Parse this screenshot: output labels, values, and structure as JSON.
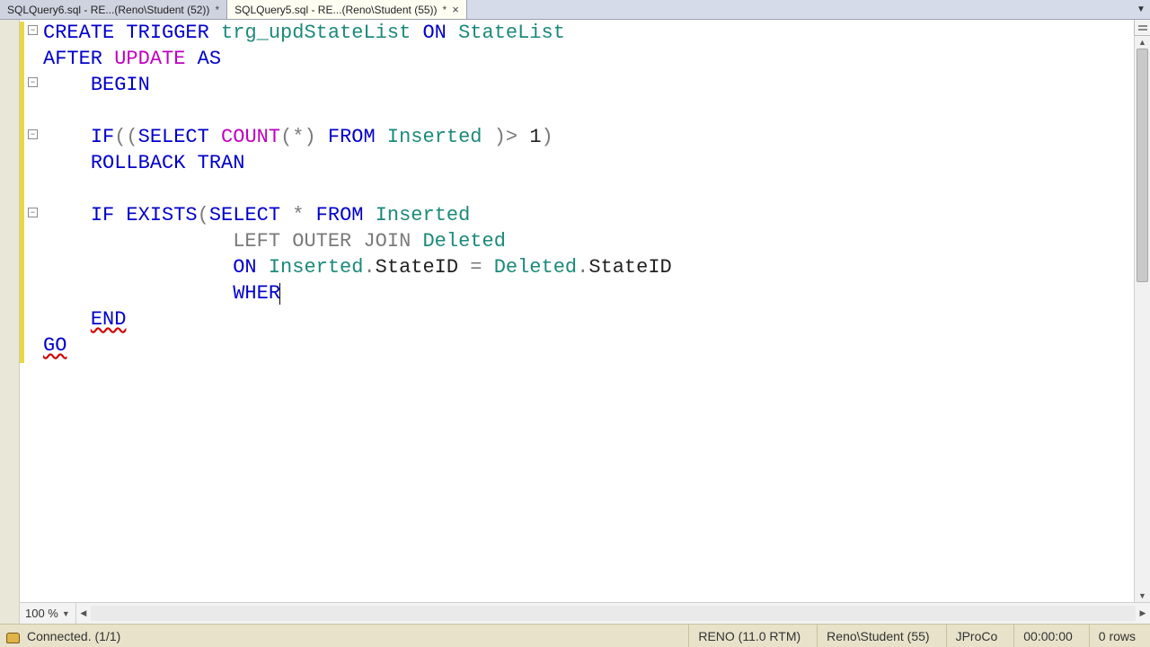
{
  "tabs": [
    {
      "label": "SQLQuery6.sql - RE...(Reno\\Student (52))",
      "dirty": "*",
      "active": false
    },
    {
      "label": "SQLQuery5.sql - RE...(Reno\\Student (55))",
      "dirty": "*",
      "active": true
    }
  ],
  "zoom": {
    "value": "100 %"
  },
  "status": {
    "connection": "Connected. (1/1)",
    "server": "RENO (11.0 RTM)",
    "user": "Reno\\Student (55)",
    "database": "JProCo",
    "elapsed": "00:00:00",
    "rows": "0 rows"
  },
  "fold_glyph": "−",
  "code": {
    "l1": {
      "a": "CREATE",
      "b": "TRIGGER",
      "c": "trg_updStateList",
      "d": "ON",
      "e": "StateList"
    },
    "l2": {
      "a": "AFTER",
      "b": "UPDATE",
      "c": "AS"
    },
    "l3": {
      "a": "BEGIN"
    },
    "l5": {
      "a": "IF",
      "b": "SELECT",
      "c": "COUNT",
      "d": "FROM",
      "e": "Inserted",
      "f": "1"
    },
    "l6": {
      "a": "ROLLBACK",
      "b": "TRAN"
    },
    "l8": {
      "a": "IF",
      "b": "EXISTS",
      "c": "SELECT",
      "d": "FROM",
      "e": "Inserted"
    },
    "l9": {
      "a": "LEFT",
      "b": "OUTER",
      "c": "JOIN",
      "d": "Deleted"
    },
    "l10": {
      "a": "ON",
      "b": "Inserted",
      "c": "StateID",
      "d": "Deleted",
      "e": "StateID"
    },
    "l11": {
      "a": "WHER"
    },
    "l12": {
      "a": "END"
    },
    "l13": {
      "a": "GO"
    }
  }
}
